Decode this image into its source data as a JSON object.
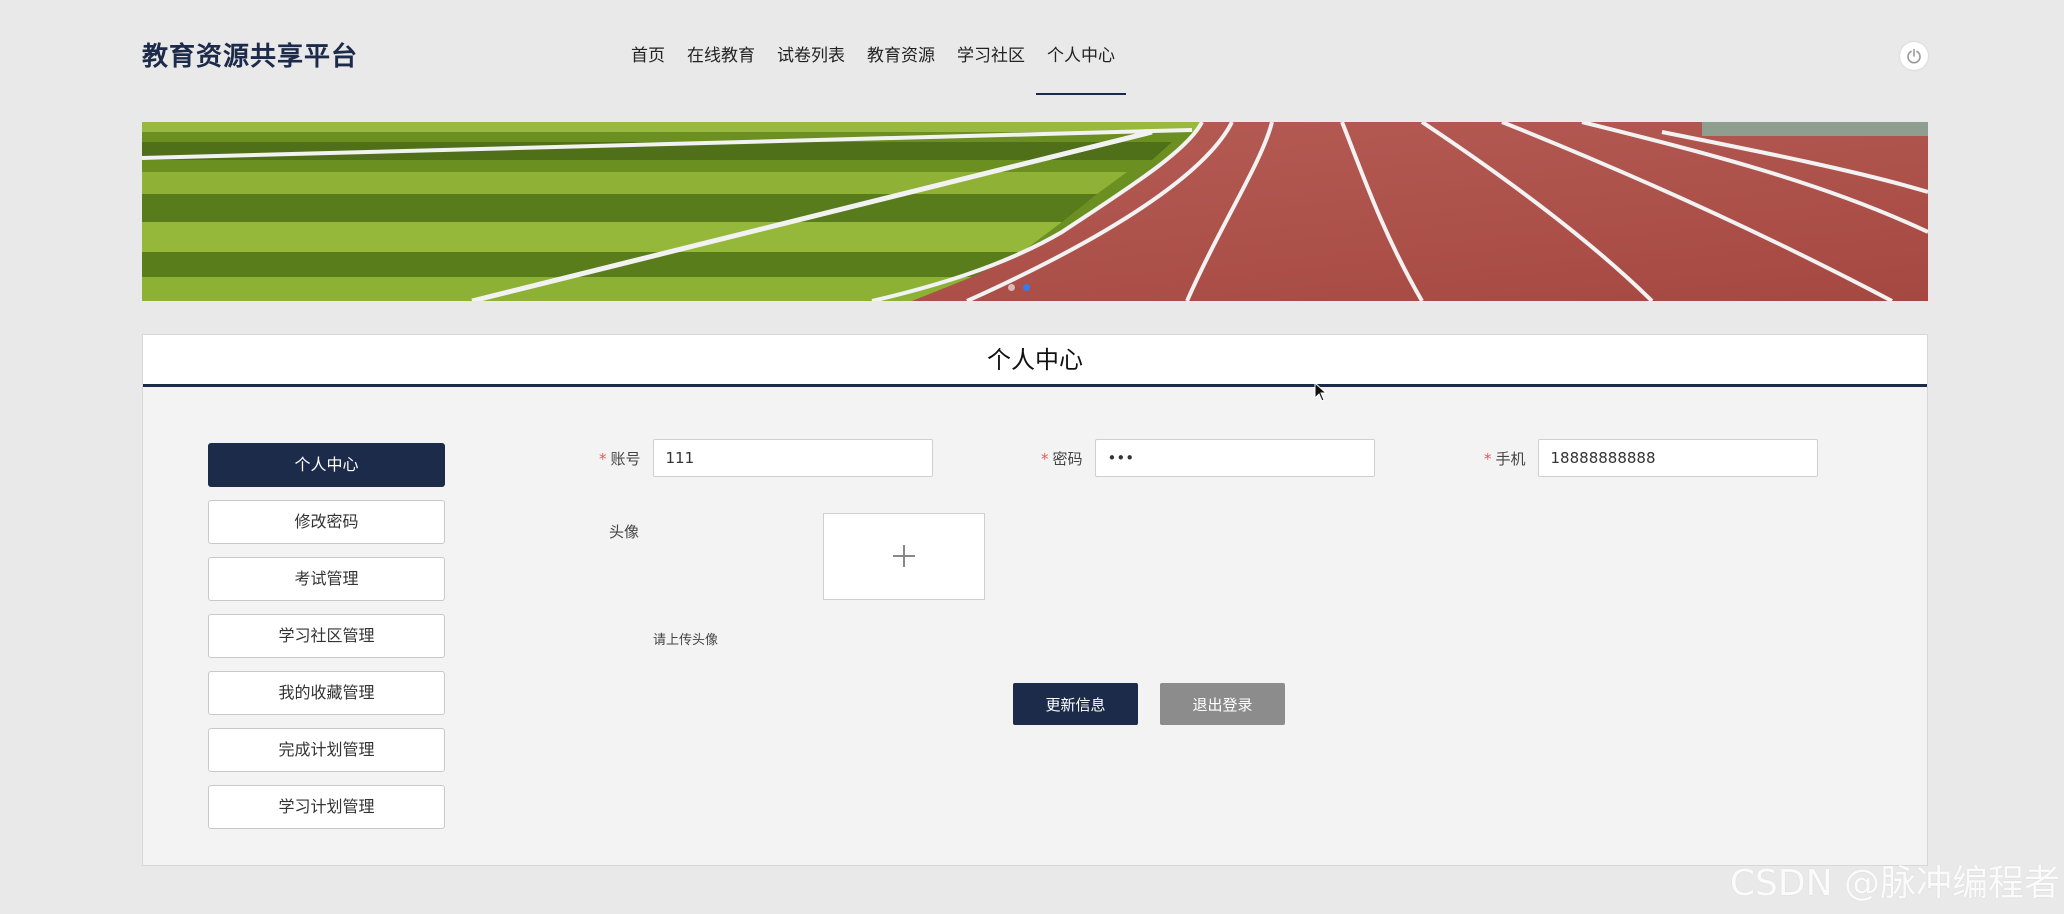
{
  "brand": {
    "title": "教育资源共享平台"
  },
  "nav": {
    "items": [
      {
        "label": "首页"
      },
      {
        "label": "在线教育"
      },
      {
        "label": "试卷列表"
      },
      {
        "label": "教育资源"
      },
      {
        "label": "学习社区"
      },
      {
        "label": "个人中心"
      }
    ],
    "active": "个人中心"
  },
  "header": {
    "power_icon": "power-icon"
  },
  "banner": {
    "slides": 2,
    "active_slide": 2
  },
  "panel": {
    "title": "个人中心"
  },
  "sidebar": {
    "items": [
      {
        "label": "个人中心"
      },
      {
        "label": "修改密码"
      },
      {
        "label": "考试管理"
      },
      {
        "label": "学习社区管理"
      },
      {
        "label": "我的收藏管理"
      },
      {
        "label": "完成计划管理"
      },
      {
        "label": "学习计划管理"
      }
    ],
    "active": "个人中心"
  },
  "form": {
    "account": {
      "required": "*",
      "label": "账号",
      "value": "111"
    },
    "password": {
      "required": "*",
      "label": "密码",
      "value": "•••"
    },
    "phone": {
      "required": "*",
      "label": "手机",
      "value": "18888888888"
    },
    "avatar": {
      "label": "头像",
      "tip": "请上传头像",
      "icon": "plus-icon"
    }
  },
  "actions": {
    "update": "更新信息",
    "logout": "退出登录"
  },
  "colors": {
    "primary": "#1c2b4a",
    "secondary_button": "#8c8c8c",
    "required_mark": "#e25b5b"
  },
  "watermark": "CSDN @脉冲编程者"
}
